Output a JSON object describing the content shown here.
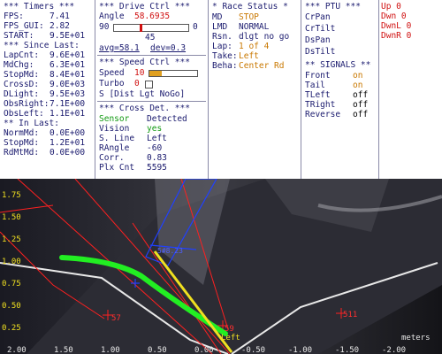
{
  "timers": {
    "header": "*** Timers ***",
    "rows": [
      {
        "label": "FPS:",
        "value": "7.41"
      },
      {
        "label": "FPS_GUI:",
        "value": "2.82"
      },
      {
        "label": "START:",
        "value": "9.5E+01"
      }
    ],
    "since_header": "*** Since Last:",
    "since_rows": [
      {
        "label": "LapCnt:",
        "value": "9.6E+01"
      },
      {
        "label": "MdChg:",
        "value": "6.3E+01"
      },
      {
        "label": "StopMd:",
        "value": "8.4E+01"
      },
      {
        "label": "CrossD:",
        "value": "9.0E+03"
      },
      {
        "label": "DLight:",
        "value": "9.5E+03"
      },
      {
        "label": "ObsRight:",
        "value": "7.1E+00"
      },
      {
        "label": "ObsLeft:",
        "value": "1.1E+01"
      }
    ],
    "inlast_header": "** In Last:",
    "inlast_rows": [
      {
        "label": "NormMd:",
        "value": "0.0E+00"
      },
      {
        "label": "StopMd:",
        "value": "1.2E+01"
      },
      {
        "label": "RdMtMd:",
        "value": "0.0E+00"
      }
    ]
  },
  "drive": {
    "header": "*** Drive Ctrl ***",
    "angle_label": "Angle",
    "angle_value": "58.6935",
    "slider_min": "90",
    "slider_max": "0",
    "slider_level": 0.35,
    "center_value": "45",
    "avg_text": "avg=58.1",
    "dev_text": "dev=0.3",
    "speed_header": "*** Speed Ctrl ***",
    "speed_label": "Speed",
    "speed_value": "10",
    "speed_level": 0.25,
    "turbo_label": "Turbo",
    "turbo_value": "0",
    "mode_text": "S [Dist Lgt NoGo]",
    "cross_header": "*** Cross Det. ***",
    "cross_rows": [
      {
        "label": "Sensor",
        "value": "Detected",
        "label_color": "#119911",
        "value_color": "#1a1a6e"
      },
      {
        "label": "Vision",
        "value": "yes",
        "label_color": "#1a1a6e",
        "value_color": "#119911"
      },
      {
        "label": "S. Line",
        "value": "Left",
        "label_color": "#1a1a6e",
        "value_color": "#1a1a6e"
      },
      {
        "label": "RAngle",
        "value": "-60",
        "label_color": "#1a1a6e",
        "value_color": "#1a1a6e"
      },
      {
        "label": "Corr.",
        "value": "0.83",
        "label_color": "#1a1a6e",
        "value_color": "#1a1a6e"
      },
      {
        "label": "Plx Cnt",
        "value": "5595",
        "label_color": "#1a1a6e",
        "value_color": "#1a1a6e"
      }
    ]
  },
  "race": {
    "header": "* Race Status *",
    "rows": [
      {
        "label": "MD",
        "value": "STOP",
        "value_color": "#c97800"
      },
      {
        "label": "LMD",
        "value": "NORMAL",
        "value_color": "#1a1a6e"
      },
      {
        "label": "Rsn.",
        "value": "dlgt no go",
        "value_color": "#1a1a6e"
      },
      {
        "label": "Lap:",
        "value": "1 of 4",
        "value_color": "#c97800"
      },
      {
        "label": "Take:",
        "value": "Left",
        "value_color": "#c97800"
      },
      {
        "label": "Beha:",
        "value": "Center Rd",
        "value_color": "#c97800"
      }
    ]
  },
  "ptu": {
    "header": "*** PTU ***",
    "rows": [
      "CrPan",
      "CrTilt",
      "DsPan",
      "DsTilt"
    ],
    "signals_header": "** SIGNALS **",
    "signals": [
      {
        "label": "Front",
        "value": "on",
        "value_color": "#c97800"
      },
      {
        "label": "Tail",
        "value": "on",
        "value_color": "#c97800"
      },
      {
        "label": "TLeft",
        "value": "off",
        "value_color": "#000000"
      },
      {
        "label": "TRight",
        "value": "off",
        "value_color": "#000000"
      },
      {
        "label": "Reverse",
        "value": "off",
        "value_color": "#000000"
      }
    ]
  },
  "dirs": {
    "rows": [
      "Up 0",
      "Dwn 0",
      "DwnL 0",
      "DwnR 0"
    ]
  },
  "camera": {
    "y_ticks": [
      "1.75",
      "1.50",
      "1.25",
      "1.00",
      "0.75",
      "0.50",
      "0.25"
    ],
    "x_ticks": [
      "2.00",
      "1.50",
      "1.00",
      "0.50",
      "0.00",
      "-0.50",
      "-1.00",
      "-1.50",
      "-2.00"
    ],
    "units_label": "meters",
    "markers": [
      {
        "label": "57"
      },
      {
        "label": "59"
      },
      {
        "label": "511"
      }
    ],
    "left_label": "Left",
    "box_label": "5#8.23"
  }
}
